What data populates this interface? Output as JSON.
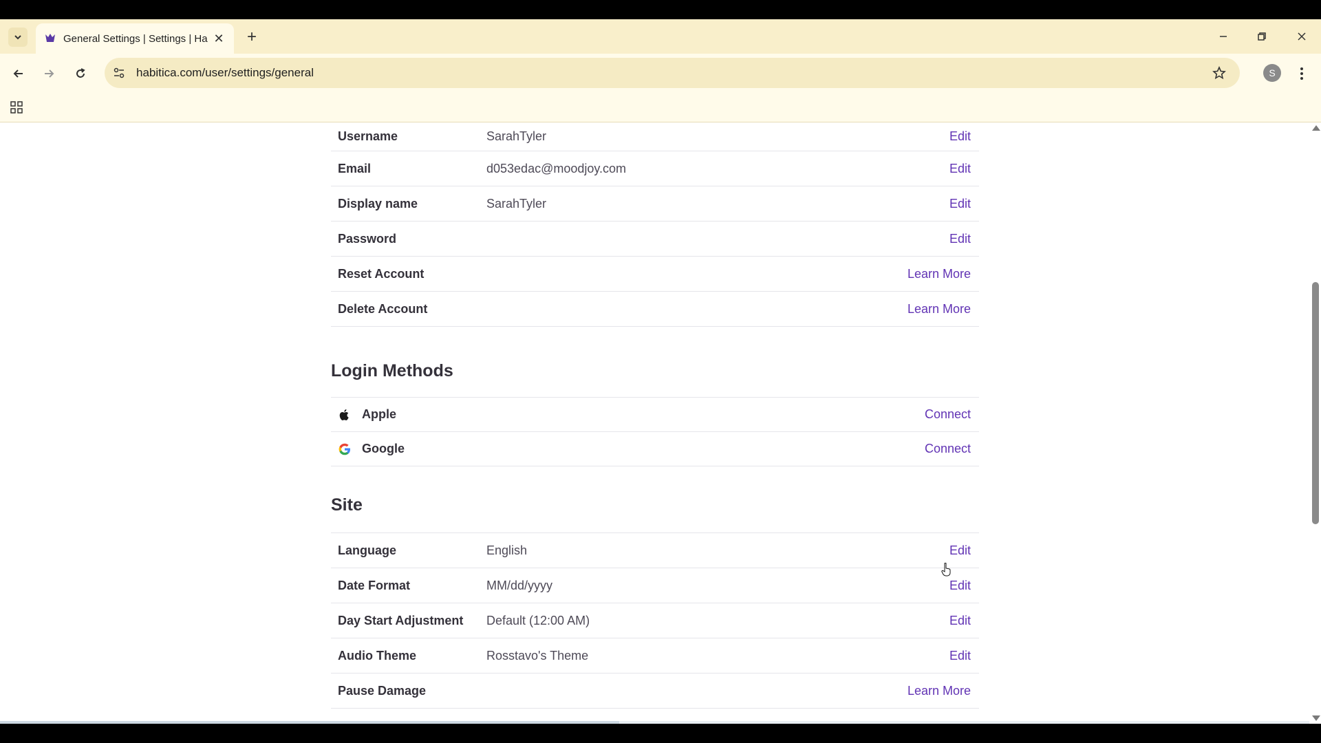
{
  "browser": {
    "tab_title": "General Settings | Settings | Habitica",
    "url": "habitica.com/user/settings/general",
    "profile_initial": "S",
    "icons": {
      "tab_list": "chevron-down-icon",
      "close_tab": "close-icon",
      "new_tab": "plus-icon",
      "minimize": "minimize-icon",
      "restore": "restore-icon",
      "close_window": "close-icon",
      "back": "arrow-left-icon",
      "forward": "arrow-right-icon",
      "reload": "reload-icon",
      "site_info": "tune-icon",
      "bookmark": "star-icon",
      "menu": "more-vert-icon",
      "apps": "apps-grid-icon"
    }
  },
  "account": {
    "rows": [
      {
        "label": "Username",
        "value": "SarahTyler",
        "action": "Edit"
      },
      {
        "label": "Email",
        "value": "d053edac@moodjoy.com",
        "action": "Edit"
      },
      {
        "label": "Display name",
        "value": "SarahTyler",
        "action": "Edit"
      },
      {
        "label": "Password",
        "value": "",
        "action": "Edit"
      },
      {
        "label": "Reset Account",
        "value": "",
        "action": "Learn More"
      },
      {
        "label": "Delete Account",
        "value": "",
        "action": "Learn More"
      }
    ]
  },
  "login_methods": {
    "title": "Login Methods",
    "rows": [
      {
        "label": "Apple",
        "icon": "apple-icon",
        "action": "Connect"
      },
      {
        "label": "Google",
        "icon": "google-icon",
        "action": "Connect"
      }
    ]
  },
  "site": {
    "title": "Site",
    "rows": [
      {
        "label": "Language",
        "value": "English",
        "action": "Edit"
      },
      {
        "label": "Date Format",
        "value": "MM/dd/yyyy",
        "action": "Edit"
      },
      {
        "label": "Day Start Adjustment",
        "value": "Default (12:00 AM)",
        "action": "Edit"
      },
      {
        "label": "Audio Theme",
        "value": "Rosstavo's Theme",
        "action": "Edit"
      },
      {
        "label": "Pause Damage",
        "value": "",
        "action": "Learn More"
      }
    ]
  },
  "colors": {
    "chrome": "#f9efcb",
    "link": "#6133b4",
    "label": "#34313a"
  }
}
